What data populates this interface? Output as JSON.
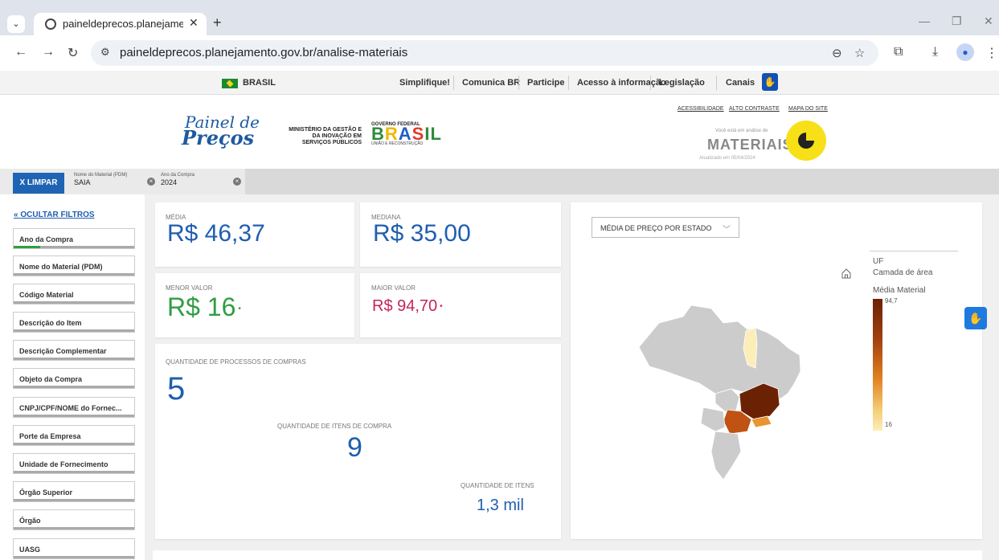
{
  "browser": {
    "tab_title": "paineldeprecos.planejamento.g",
    "url": "paineldeprecos.planejamento.gov.br/analise-materiais"
  },
  "govbar": {
    "country": "BRASIL",
    "links": [
      "Simplifique!",
      "Comunica BR",
      "Participe",
      "Acesso à informação",
      "Legislação",
      "Canais"
    ]
  },
  "header": {
    "logo_line1": "Painel de",
    "logo_line2": "Preços",
    "ministry": "MINISTÉRIO DA GESTÃO E DA INOVAÇÃO EM SERVIÇOS PÚBLICOS",
    "gov_top": "GOVERNO FEDERAL",
    "gov_bottom": "UNIÃO E RECONSTRUÇÃO",
    "links": [
      "ACESSIBILIDADE",
      "ALTO CONTRASTE",
      "MAPA DO SITE"
    ],
    "analysis_sub": "Você está em análise de",
    "analysis_title": "MATERIAIS",
    "updated": "Atualizado em 05/04/2024"
  },
  "filter_bar": {
    "clear_label": "X LIMPAR",
    "chips": [
      {
        "label": "Nome do Material (PDM)",
        "value": "SAIA"
      },
      {
        "label": "Ano da Compra",
        "value": "2024"
      }
    ]
  },
  "sidebar": {
    "toggle_label": "OCULTAR FILTROS",
    "filters": [
      {
        "label": "Ano da Compra",
        "fill": 0.22
      },
      {
        "label": "Nome do Material (PDM)",
        "fill": 0
      },
      {
        "label": "Código Material",
        "fill": 0
      },
      {
        "label": "Descrição do Item",
        "fill": 0
      },
      {
        "label": "Descrição Complementar",
        "fill": 0
      },
      {
        "label": "Objeto da Compra",
        "fill": 0
      },
      {
        "label": "CNPJ/CPF/NOME do Fornec...",
        "fill": 0
      },
      {
        "label": "Porte da Empresa",
        "fill": 0
      },
      {
        "label": "Unidade de Fornecimento",
        "fill": 0
      },
      {
        "label": "Órgão Superior",
        "fill": 0
      },
      {
        "label": "Órgão",
        "fill": 0
      },
      {
        "label": "UASG",
        "fill": 0
      }
    ]
  },
  "kpis": {
    "media_label": "MÉDIA",
    "media_value": "R$ 46,37",
    "mediana_label": "MEDIANA",
    "mediana_value": "R$ 35,00",
    "menor_label": "MENOR VALOR",
    "menor_value": "R$ 16",
    "maior_label": "MAIOR VALOR",
    "maior_value": "R$ 94,70",
    "processos_label": "QUANTIDADE DE PROCESSOS DE COMPRAS",
    "processos_value": "5",
    "itens_compra_label": "QUANTIDADE DE ITENS DE COMPRA",
    "itens_compra_value": "9",
    "itens_label": "QUANTIDADE DE ITENS",
    "itens_value": "1,3 mil",
    "menor_color": "#2f9e44",
    "maior_color": "#c2255c",
    "value_color": "#1f5eb0"
  },
  "map": {
    "dropdown": "MÉDIA DE PREÇO POR ESTADO",
    "legend_title": "UF",
    "legend_layer": "Camada de área",
    "legend_measure": "Média Material",
    "legend_max": "94,7",
    "legend_min": "16"
  }
}
